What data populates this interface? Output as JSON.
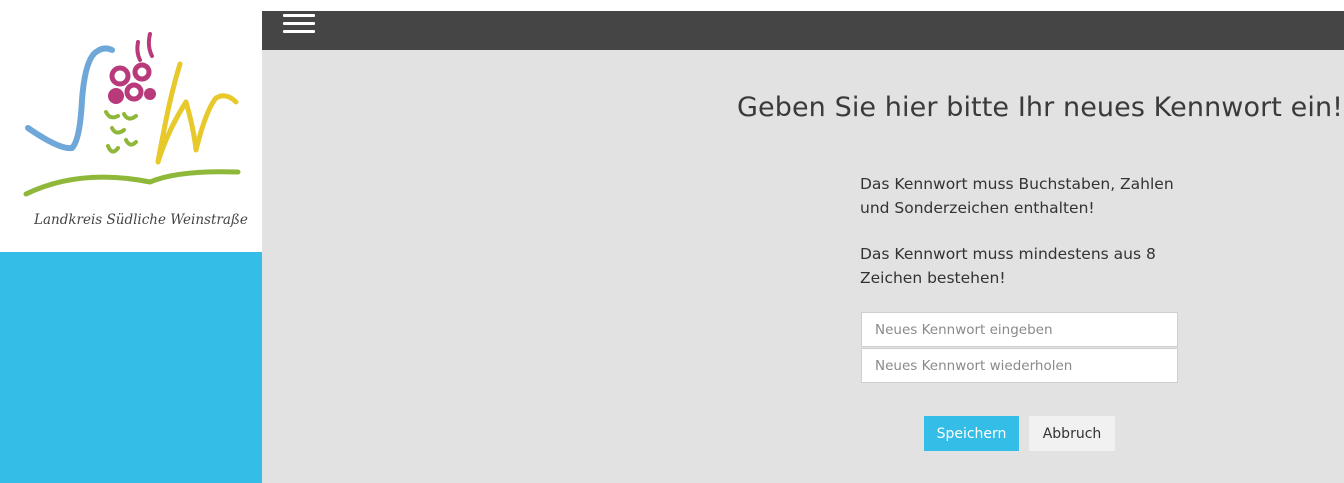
{
  "sidebar": {
    "logo_caption": "Landkreis Südliche Weinstraße"
  },
  "topbar": {
    "menu_icon": "hamburger-menu-icon"
  },
  "main": {
    "title": "Geben Sie hier bitte Ihr neues Kennwort ein!",
    "info": [
      "Das Kennwort muss Buchstaben, Zahlen und Sonderzeichen enthalten!",
      "Das Kennwort muss mindestens aus 8 Zeichen bestehen!"
    ],
    "new_password": {
      "value": "",
      "placeholder": "Neues Kennwort eingeben"
    },
    "repeat_password": {
      "value": "",
      "placeholder": "Neues Kennwort wiederholen"
    },
    "save_label": "Speichern",
    "cancel_label": "Abbruch"
  },
  "colors": {
    "accent": "#34bde6",
    "topbar": "#454545",
    "main_background": "#e2e2e2",
    "logo_magenta": "#b83a7a",
    "logo_green": "#8fb83a",
    "logo_yellow": "#e8c92b",
    "logo_blue": "#6fa8d8"
  }
}
